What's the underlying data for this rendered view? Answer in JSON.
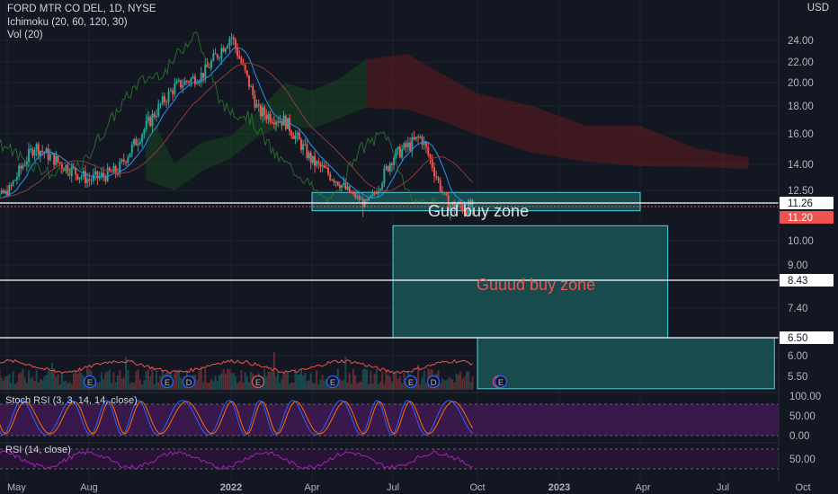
{
  "legend": {
    "symbol": "FORD MTR CO DEL, 1D, NYSE",
    "ichimoku": "Ichimoku (20, 60, 120, 30)",
    "volume": "Vol (20)",
    "stoch_rsi": "Stoch RSI (3, 3, 14, 14, close)",
    "rsi": "RSI (14, close)"
  },
  "currency": "USD",
  "colors": {
    "background": "#131722",
    "up": "#26a69a",
    "down": "#ef5350",
    "zone_fill": "#1b5e5e",
    "zone_stroke": "#4dd0e1",
    "stoch_band": "#4a1a5c",
    "rsi_band": "#2a1436",
    "rsi_line": "#9c27b0",
    "stoch_k": "#2962ff",
    "stoch_d": "#ff6d00",
    "price_tag": "#ef5350"
  },
  "annotations": {
    "zone1": "Gud buy zone",
    "zone2": "Guuud buy zone"
  },
  "chart_data": {
    "type": "candlestick",
    "title": "FORD MTR CO DEL, 1D, NYSE",
    "price_axis": [
      "24.00",
      "22.00",
      "20.00",
      "18.00",
      "16.00",
      "14.00",
      "12.50",
      "10.00",
      "9.00",
      "7.40",
      "6.00",
      "5.50"
    ],
    "price_tags": [
      {
        "label": "11.26",
        "value": 11.26,
        "style": "line"
      },
      {
        "label": "11.20",
        "value": 11.2,
        "style": "current"
      },
      {
        "label": "8.43",
        "value": 8.43,
        "style": "line"
      },
      {
        "label": "6.50",
        "value": 6.5,
        "style": "line"
      }
    ],
    "time_axis": [
      "May",
      "Aug",
      "2022",
      "Apr",
      "Jul",
      "Oct",
      "2023",
      "Apr",
      "Jul",
      "Oct"
    ],
    "earnings_markers": [
      "E",
      "E",
      "D",
      "E",
      "E",
      "E",
      "D",
      "E",
      "E"
    ],
    "stoch_axis": [
      "100.00",
      "50.00",
      "0.00"
    ],
    "rsi_axis": [
      "50.00"
    ],
    "close_series": [
      {
        "date": "2021-04",
        "close": 11.5
      },
      {
        "date": "2021-05",
        "close": 12.3
      },
      {
        "date": "2021-06",
        "close": 15.2
      },
      {
        "date": "2021-07",
        "close": 14.0
      },
      {
        "date": "2021-08",
        "close": 13.1
      },
      {
        "date": "2021-09",
        "close": 13.6
      },
      {
        "date": "2021-10",
        "close": 16.5
      },
      {
        "date": "2021-11",
        "close": 19.6
      },
      {
        "date": "2021-12",
        "close": 20.8
      },
      {
        "date": "2022-01",
        "close": 24.5
      },
      {
        "date": "2022-02",
        "close": 17.6
      },
      {
        "date": "2022-03",
        "close": 16.9
      },
      {
        "date": "2022-04",
        "close": 14.2
      },
      {
        "date": "2022-05",
        "close": 13.0
      },
      {
        "date": "2022-06",
        "close": 11.2
      },
      {
        "date": "2022-07",
        "close": 14.5
      },
      {
        "date": "2022-08",
        "close": 15.8
      },
      {
        "date": "2022-09",
        "close": 11.2
      }
    ],
    "buy_zones": [
      {
        "label": "Gud buy zone",
        "low": 11.0,
        "high": 12.3,
        "start": "2022-04",
        "end": "2023-04"
      },
      {
        "label": "Guuud buy zone",
        "low": 6.5,
        "high": 10.5,
        "start": "2022-07",
        "end": "2023-05"
      },
      {
        "label": "",
        "low": 5.2,
        "high": 6.5,
        "start": "2022-10",
        "end": "2023-09"
      }
    ]
  }
}
